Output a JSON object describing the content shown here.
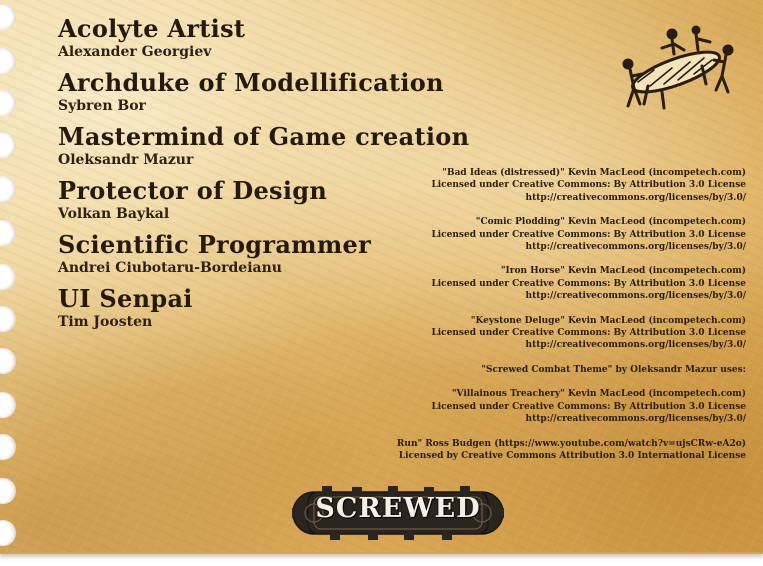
{
  "credits": [
    {
      "role": "Acolyte Artist",
      "name": "Alexander Georgiev"
    },
    {
      "role": "Archduke of Modellification",
      "name": "Sybren Bor"
    },
    {
      "role": "Mastermind of Game creation",
      "name": "Oleksandr Mazur"
    },
    {
      "role": "Protector of Design",
      "name": "Volkan Baykal"
    },
    {
      "role": "Scientific Programmer",
      "name": "Andrei Ciubotaru-Bordeianu"
    },
    {
      "role": "UI Senpai",
      "name": "Tim Joosten"
    }
  ],
  "music": [
    [
      "\"Bad Ideas (distressed)\" Kevin MacLeod (incompetech.com)",
      "Licensed under Creative Commons: By Attribution 3.0 License",
      "http://creativecommons.org/licenses/by/3.0/"
    ],
    [
      "\"Comic Plodding\" Kevin MacLeod (incompetech.com)",
      "Licensed under Creative Commons: By Attribution 3.0 License",
      "http://creativecommons.org/licenses/by/3.0/"
    ],
    [
      "\"Iron Horse\" Kevin MacLeod (incompetech.com)",
      "Licensed under Creative Commons: By Attribution 3.0 License",
      "http://creativecommons.org/licenses/by/3.0/"
    ],
    [
      "\"Keystone Deluge\" Kevin MacLeod (incompetech.com)",
      "Licensed under Creative Commons: By Attribution 3.0 License",
      "http://creativecommons.org/licenses/by/3.0/"
    ],
    [
      "\"Screwed Combat Theme\" by Oleksandr Mazur uses:"
    ],
    [
      "\"Villainous Treachery\" Kevin MacLeod (incompetech.com)",
      "Licensed under Creative Commons: By Attribution 3.0 License",
      "http://creativecommons.org/licenses/by/3.0/"
    ],
    [
      "Run\" Ross Budgen (https://www.youtube.com/watch?v=ujsCRw-eA2o)",
      "Licensed by Creative Commons Attribution 3.0 International License"
    ]
  ],
  "logo": {
    "text": "SCREWED"
  },
  "colors": {
    "paper": "#e9c57e",
    "ink": "#2a1e12",
    "logo_plate": "#2b2520"
  },
  "icons": {
    "corner": "table-with-figures-icon",
    "logo_frame": "gear-frame-icon"
  }
}
